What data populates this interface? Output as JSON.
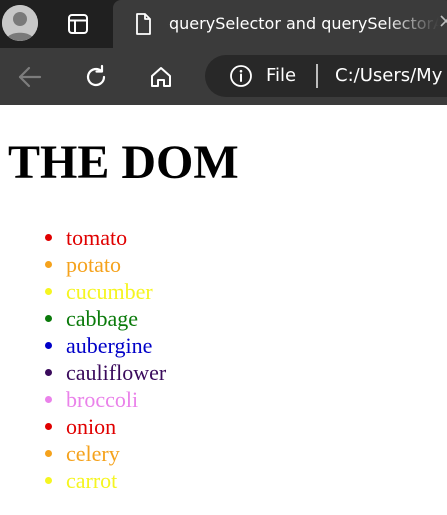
{
  "tab": {
    "title": "querySelector and querySelectorAll"
  },
  "toolbar": {
    "site_info_label": "File",
    "url": "C:/Users/My"
  },
  "page": {
    "heading": "THE DOM",
    "items": [
      {
        "text": "tomato",
        "color": "#e00000"
      },
      {
        "text": "potato",
        "color": "#f5a21c"
      },
      {
        "text": "cucumber",
        "color": "#f5f520"
      },
      {
        "text": "cabbage",
        "color": "#0a7a0a"
      },
      {
        "text": "aubergine",
        "color": "#0000c8"
      },
      {
        "text": "cauliflower",
        "color": "#3a0a5c"
      },
      {
        "text": "broccoli",
        "color": "#ea82ea"
      },
      {
        "text": "onion",
        "color": "#e00000"
      },
      {
        "text": "celery",
        "color": "#f5a21c"
      },
      {
        "text": "carrot",
        "color": "#f5f520"
      }
    ]
  },
  "icons": {
    "profile": "profile-avatar-icon",
    "tab_actions": "tab-actions-icon",
    "tab_favicon": "document-icon",
    "tab_close": "close-icon",
    "back": "back-arrow-icon",
    "refresh": "refresh-icon",
    "home": "home-icon",
    "site_info": "info-icon"
  },
  "colors": {
    "tabstrip_bg": "#202020",
    "toolbar_bg": "#3b3b3b",
    "omnibox_bg": "#282828",
    "page_bg": "#ffffff"
  }
}
